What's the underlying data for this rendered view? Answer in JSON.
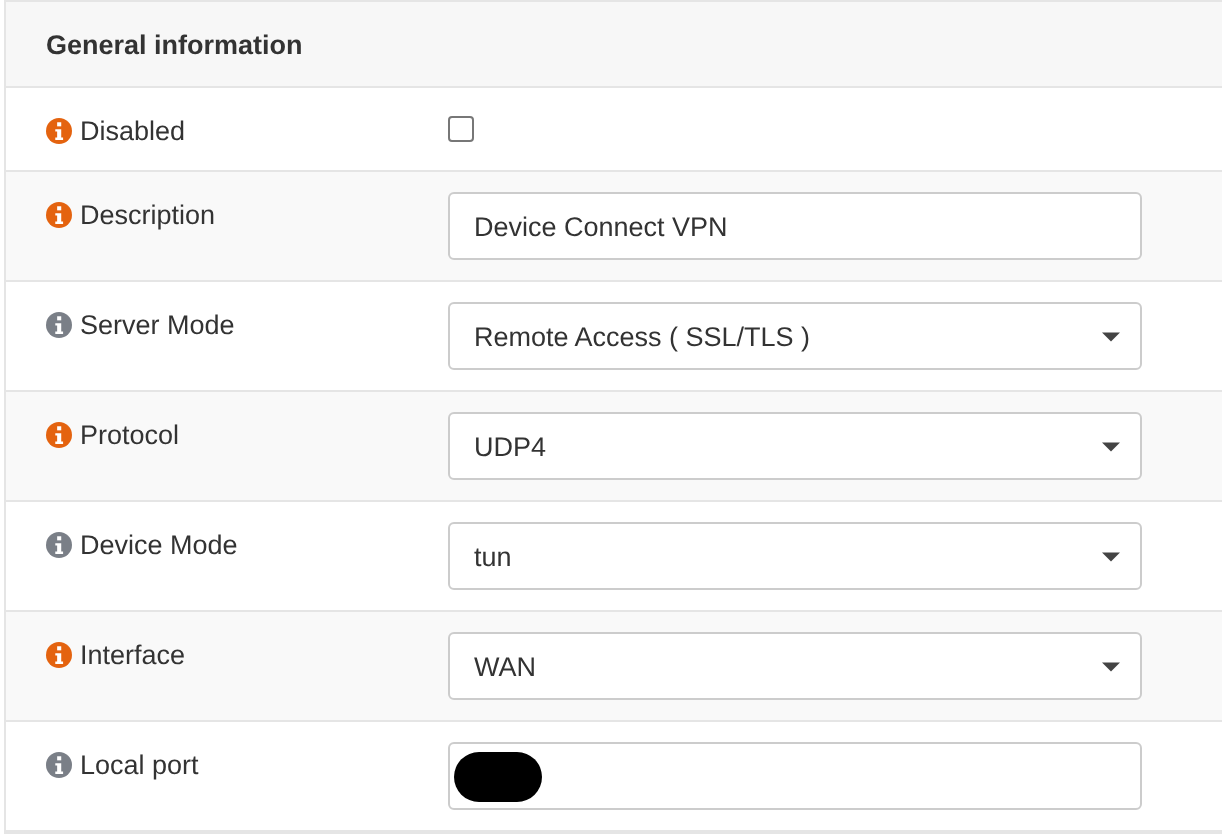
{
  "section": {
    "title": "General information"
  },
  "rows": [
    {
      "label": "Disabled",
      "color": "#e4630f",
      "kind": "checkbox",
      "checked": false
    },
    {
      "label": "Description",
      "color": "#e4630f",
      "kind": "text",
      "value": "Device Connect VPN"
    },
    {
      "label": "Server Mode",
      "color": "#7a7f87",
      "kind": "select",
      "value": "Remote Access ( SSL/TLS )"
    },
    {
      "label": "Protocol",
      "color": "#e4630f",
      "kind": "select",
      "value": "UDP4"
    },
    {
      "label": "Device Mode",
      "color": "#7a7f87",
      "kind": "select",
      "value": "tun"
    },
    {
      "label": "Interface",
      "color": "#e4630f",
      "kind": "select",
      "value": "WAN"
    },
    {
      "label": "Local port",
      "color": "#7a7f87",
      "kind": "redacted"
    }
  ]
}
